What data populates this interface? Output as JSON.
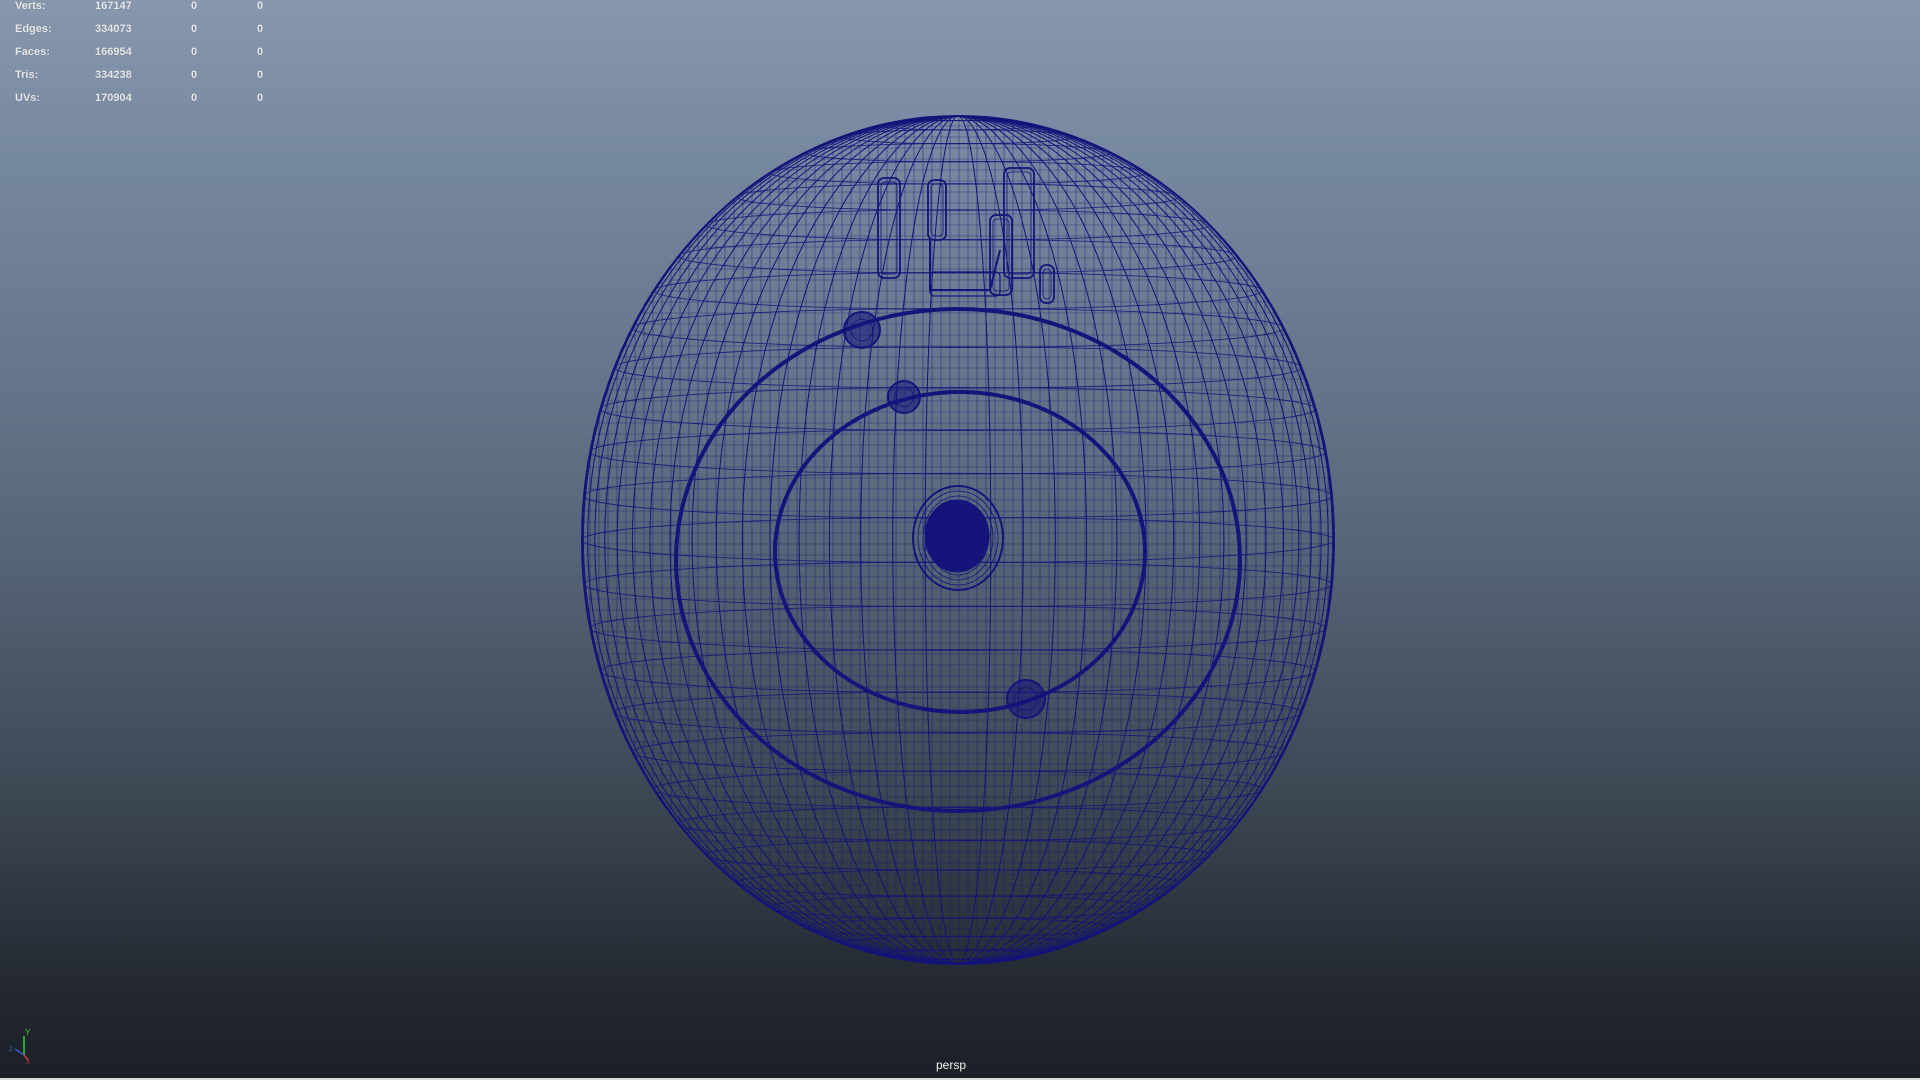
{
  "viewport": {
    "camera": "persp",
    "wireframe_color": "#14147a",
    "background_top": "#8797ad",
    "background_bottom": "#1c2026"
  },
  "hud": {
    "rows": [
      {
        "label": "Verts:",
        "count": "167147",
        "selected": "0",
        "component": "0"
      },
      {
        "label": "Edges:",
        "count": "334073",
        "selected": "0",
        "component": "0"
      },
      {
        "label": "Faces:",
        "count": "166954",
        "selected": "0",
        "component": "0"
      },
      {
        "label": "Tris:",
        "count": "334238",
        "selected": "0",
        "component": "0"
      },
      {
        "label": "UVs:",
        "count": "170904",
        "selected": "0",
        "component": "0"
      }
    ]
  },
  "axis_gizmo": {
    "y_label": "Y",
    "x_label": "X",
    "z_label": "Z",
    "colors": {
      "x": "#d03a3a",
      "y": "#3ad03a",
      "z": "#3a5ad0"
    }
  }
}
